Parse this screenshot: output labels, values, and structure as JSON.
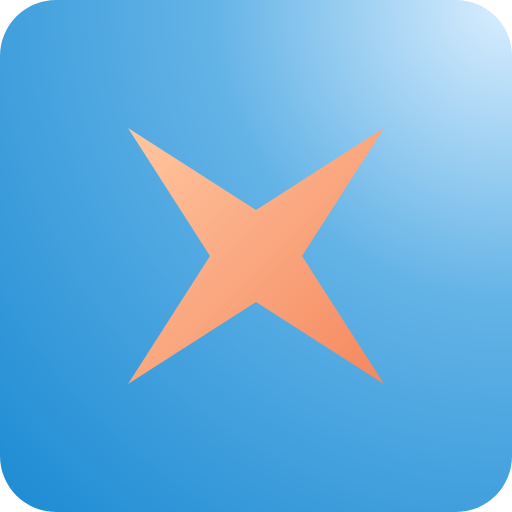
{
  "icon": {
    "name": "four-point-star-icon",
    "colors": {
      "background_light": "#dcefff",
      "background_mid": "#63b3e6",
      "background_dark": "#1d8bd3",
      "star_light": "#ffc7a0",
      "star_dark": "#f5875e"
    }
  }
}
